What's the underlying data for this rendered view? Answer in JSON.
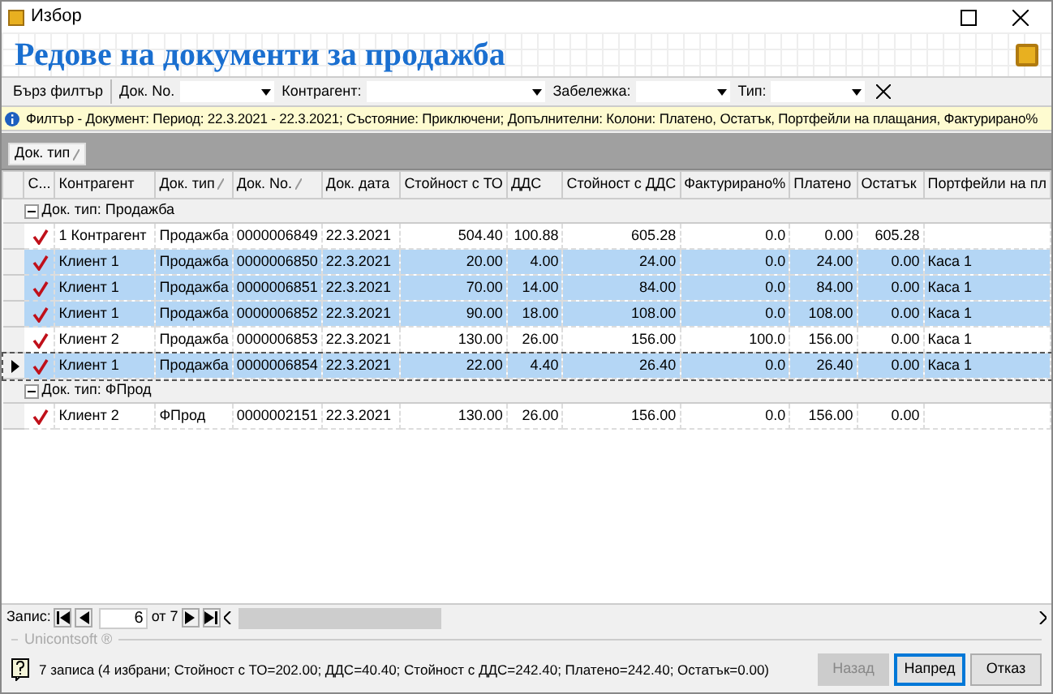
{
  "window": {
    "title": "Избор"
  },
  "header": {
    "title": "Редове на документи за продажба"
  },
  "filter_bar": {
    "quick_filter": "Бърз филтър",
    "fields": [
      {
        "label": "Док. No."
      },
      {
        "label": "Контрагент:"
      },
      {
        "label": "Забележка:"
      },
      {
        "label": "Тип:"
      }
    ]
  },
  "info_bar": {
    "text": "Филтър - Документ: Период: 22.3.2021 - 22.3.2021; Състояние: Приключени; Допълнителни: Колони: Платено, Остатък, Портфейли на плащания, Фактурирано%"
  },
  "group_panel": {
    "chips": [
      "Док. тип"
    ]
  },
  "grid": {
    "columns": [
      {
        "label": "С...",
        "sorted": false
      },
      {
        "label": "Контрагент",
        "sorted": false
      },
      {
        "label": "Док. тип",
        "sorted": true
      },
      {
        "label": "Док. No.",
        "sorted": true
      },
      {
        "label": "Док. дата",
        "sorted": false
      },
      {
        "label": "Стойност с ТО",
        "sorted": false
      },
      {
        "label": "ДДС",
        "sorted": false
      },
      {
        "label": "Стойност с ДДС",
        "sorted": false
      },
      {
        "label": "Фактурирано%",
        "sorted": false
      },
      {
        "label": "Платено",
        "sorted": false
      },
      {
        "label": "Остатък",
        "sorted": false
      },
      {
        "label": "Портфейли на пл",
        "sorted": false
      }
    ],
    "groups": [
      {
        "label": "Док. тип: Продажба",
        "expanded": true,
        "rows": [
          {
            "checked": true,
            "selected": false,
            "current": false,
            "cells": [
              "1 Контрагент",
              "Продажба",
              "0000006849",
              "22.3.2021",
              "504.40",
              "100.88",
              "605.28",
              "0.0",
              "0.00",
              "605.28",
              ""
            ]
          },
          {
            "checked": true,
            "selected": true,
            "current": false,
            "cells": [
              "Клиент 1",
              "Продажба",
              "0000006850",
              "22.3.2021",
              "20.00",
              "4.00",
              "24.00",
              "0.0",
              "24.00",
              "0.00",
              "Каса 1"
            ]
          },
          {
            "checked": true,
            "selected": true,
            "current": false,
            "cells": [
              "Клиент 1",
              "Продажба",
              "0000006851",
              "22.3.2021",
              "70.00",
              "14.00",
              "84.00",
              "0.0",
              "84.00",
              "0.00",
              "Каса 1"
            ]
          },
          {
            "checked": true,
            "selected": true,
            "current": false,
            "cells": [
              "Клиент 1",
              "Продажба",
              "0000006852",
              "22.3.2021",
              "90.00",
              "18.00",
              "108.00",
              "0.0",
              "108.00",
              "0.00",
              "Каса 1"
            ]
          },
          {
            "checked": true,
            "selected": false,
            "current": false,
            "cells": [
              "Клиент 2",
              "Продажба",
              "0000006853",
              "22.3.2021",
              "130.00",
              "26.00",
              "156.00",
              "100.0",
              "156.00",
              "0.00",
              "Каса 1"
            ]
          },
          {
            "checked": true,
            "selected": true,
            "current": true,
            "cells": [
              "Клиент 1",
              "Продажба",
              "0000006854",
              "22.3.2021",
              "22.00",
              "4.40",
              "26.40",
              "0.0",
              "26.40",
              "0.00",
              "Каса 1"
            ]
          }
        ]
      },
      {
        "label": "Док. тип: ФПрод",
        "expanded": true,
        "rows": [
          {
            "checked": true,
            "selected": false,
            "current": false,
            "cells": [
              "Клиент 2",
              "ФПрод",
              "0000002151",
              "22.3.2021",
              "130.00",
              "26.00",
              "156.00",
              "0.0",
              "156.00",
              "0.00",
              ""
            ]
          }
        ]
      }
    ]
  },
  "navigator": {
    "label": "Запис:",
    "value": "6",
    "of": "от 7"
  },
  "brand": "Unicontsoft ®",
  "status": {
    "text": "7 записа (4 избрани; Стойност с ТО=202.00; ДДС=40.40; Стойност с ДДС=242.40; Платено=242.40; Остатък=0.00)"
  },
  "buttons": [
    {
      "label": "Назад",
      "disabled": true,
      "default": false
    },
    {
      "label": "Напред",
      "disabled": false,
      "default": true
    },
    {
      "label": "Отказ",
      "disabled": false,
      "default": false
    }
  ]
}
